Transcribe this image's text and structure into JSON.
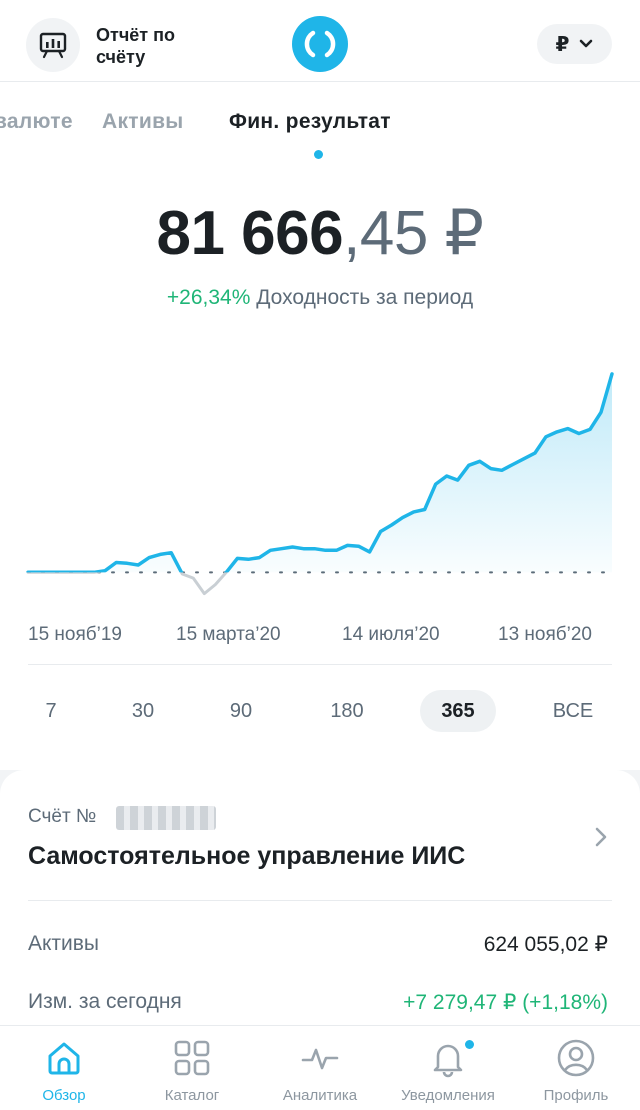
{
  "header": {
    "report_label": "Отчёт по счёту",
    "currency_symbol": "₽",
    "report_icon": "presentation-chart-icon",
    "logo_icon": "app-logo-icon",
    "currency_chevron_icon": "chevron-down-icon"
  },
  "tabs": [
    {
      "label": "валюте",
      "active": false
    },
    {
      "label": "Активы",
      "active": false
    },
    {
      "label": "Фин. результат",
      "active": true
    }
  ],
  "summary": {
    "value_int": "81 666",
    "value_frac": ",45 ₽",
    "yield_pct": "+26,34%",
    "yield_label": "Доходность за период"
  },
  "chart_data": {
    "type": "line",
    "x_ticks": [
      "15 нояб’19",
      "15 марта’20",
      "14 июля’20",
      "13 нояб’20"
    ],
    "baseline": 0,
    "series": [
      {
        "values": [
          0,
          0,
          0,
          0,
          0,
          0,
          0,
          0.2,
          1.2,
          1.1,
          0.9,
          1.8,
          2.2,
          2.4,
          -0.2,
          -0.7,
          -2.6,
          -1.5,
          0,
          1.7,
          1.6,
          1.8,
          2.7,
          2.9,
          3.1,
          2.9,
          2.9,
          2.7,
          2.7,
          3.3,
          3.2,
          2.5,
          5.0,
          5.8,
          6.7,
          7.4,
          7.7,
          10.8,
          11.8,
          11.3,
          13.1,
          13.6,
          12.7,
          12.5,
          13.2,
          13.9,
          14.6,
          16.6,
          17.2,
          17.6,
          17.0,
          17.5,
          19.6,
          24.3
        ],
        "color": "#1fb5e8"
      }
    ],
    "negative_color": "#c9cfd4",
    "ylim": [
      -4,
      26
    ]
  },
  "periods": [
    {
      "label": "7",
      "active": false
    },
    {
      "label": "30",
      "active": false
    },
    {
      "label": "90",
      "active": false
    },
    {
      "label": "180",
      "active": false
    },
    {
      "label": "365",
      "active": true
    },
    {
      "label": "ВСЕ",
      "active": false
    }
  ],
  "account": {
    "number_label": "Счёт №",
    "name": "Самостоятельное управление ИИС",
    "assets_label": "Активы",
    "assets_value": "624 055,02 ₽",
    "change_label": "Изм. за сегодня",
    "change_value": "+7 279,47 ₽ (+1,18%)"
  },
  "nav": [
    {
      "label": "Обзор",
      "icon": "home-icon",
      "active": true
    },
    {
      "label": "Каталог",
      "icon": "grid-icon",
      "active": false
    },
    {
      "label": "Аналитика",
      "icon": "pulse-icon",
      "active": false
    },
    {
      "label": "Уведомления",
      "icon": "bell-icon",
      "active": false,
      "badge": true
    },
    {
      "label": "Профиль",
      "icon": "profile-icon",
      "active": false
    }
  ],
  "colors": {
    "accent": "#1fb5e8",
    "positive": "#1fb577",
    "text_primary": "#1c2125",
    "text_secondary": "#5d6b78"
  }
}
